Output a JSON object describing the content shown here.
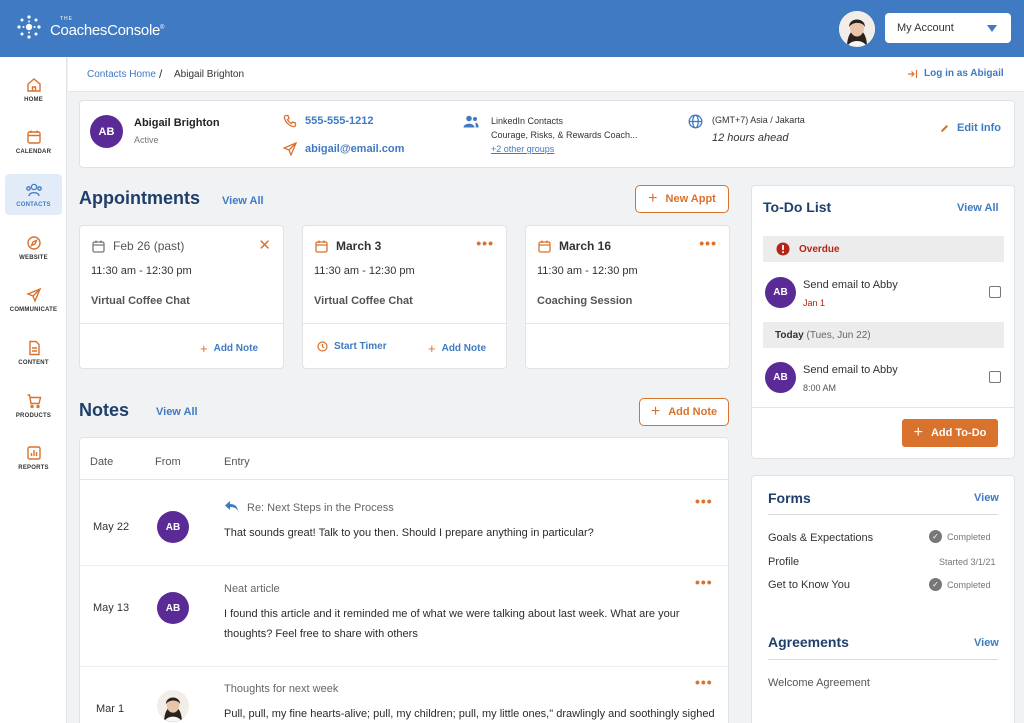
{
  "app": {
    "logo_small": "THE",
    "logo_name": "CoachesConsole",
    "logo_mark": "®",
    "account_label": "My Account"
  },
  "nav": [
    {
      "label": "HOME",
      "icon": "home-icon"
    },
    {
      "label": "CALENDAR",
      "icon": "calendar-icon"
    },
    {
      "label": "CONTACTS",
      "icon": "contacts-icon",
      "active": true
    },
    {
      "label": "WEBSITE",
      "icon": "compass-icon"
    },
    {
      "label": "COMMUNICATE",
      "icon": "send-icon"
    },
    {
      "label": "CONTENT",
      "icon": "document-icon"
    },
    {
      "label": "PRODUCTS",
      "icon": "cart-icon"
    },
    {
      "label": "REPORTS",
      "icon": "chart-icon"
    }
  ],
  "breadcrumb": {
    "parent": "Contacts Home",
    "separator": "/",
    "current": "Abigail Brighton",
    "login": "Log in as Abigail"
  },
  "contact": {
    "initials": "AB",
    "name": "Abigail Brighton",
    "status": "Active",
    "phone": "555-555-1212",
    "email": "abigail@email.com",
    "group_title": "LinkedIn Contacts",
    "group_sub": "Courage, Risks, & Rewards Coach...",
    "group_more": "+2 other groups",
    "timezone": "(GMT+7) Asia / Jakarta",
    "time_offset": "12 hours ahead",
    "edit": "Edit Info"
  },
  "appointments": {
    "heading": "Appointments",
    "view_all": "View All",
    "new_button": "New Appt",
    "cards": [
      {
        "date": "Feb 26 (past)",
        "time": "11:30 am - 12:30 pm",
        "title": "Virtual Coffee Chat",
        "add_note": "Add Note"
      },
      {
        "date": "March 3",
        "time": "11:30 am - 12:30 pm",
        "title": "Virtual Coffee Chat",
        "timer": "Start Timer",
        "add_note": "Add Note"
      },
      {
        "date": "March 16",
        "time": "11:30 am - 12:30 pm",
        "title": "Coaching Session"
      }
    ]
  },
  "notes": {
    "heading": "Notes",
    "view_all": "View All",
    "add_button": "Add Note",
    "columns": [
      "Date",
      "From",
      "Entry"
    ],
    "rows": [
      {
        "date": "May 22",
        "from": "AB",
        "subject": "Re: Next Steps in the Process",
        "body": "That sounds great! Talk to you then. Should I prepare anything in particular?"
      },
      {
        "date": "May 13",
        "from": "AB",
        "subject": "Neat article",
        "body": "I found this article and it reminded me of what we were talking about last week. What are your thoughts? Feel free to share with others"
      },
      {
        "date": "Mar 1",
        "from": "photo",
        "subject": "Thoughts for next week",
        "body": "Pull, pull, my fine hearts-alive; pull, my children; pull, my little ones,\" drawlingly and soothingly sighed"
      }
    ]
  },
  "todo": {
    "heading": "To-Do List",
    "view_all": "View All",
    "overdue_label": "Overdue",
    "today_label": "Today",
    "today_date": "(Tues, Jun 22)",
    "items": [
      {
        "initials": "AB",
        "text": "Send email to Abby",
        "meta": "Jan 1"
      },
      {
        "initials": "AB",
        "text": "Send email to Abby",
        "meta": "8:00 AM"
      }
    ],
    "add_button": "Add To-Do"
  },
  "forms": {
    "heading": "Forms",
    "view": "View",
    "rows": [
      {
        "name": "Goals & Expectations",
        "status": "Completed"
      },
      {
        "name": "Profile",
        "status": "Started 3/1/21"
      },
      {
        "name": "Get to Know You",
        "status": "Completed"
      }
    ]
  },
  "agreements": {
    "heading": "Agreements",
    "view": "View",
    "rows": [
      {
        "name": "Welcome Agreement"
      }
    ]
  },
  "colors": {
    "brand": "#3f7ac3",
    "accent": "#d9722d",
    "avatar": "#5a2a96",
    "overdue": "#b42318"
  }
}
